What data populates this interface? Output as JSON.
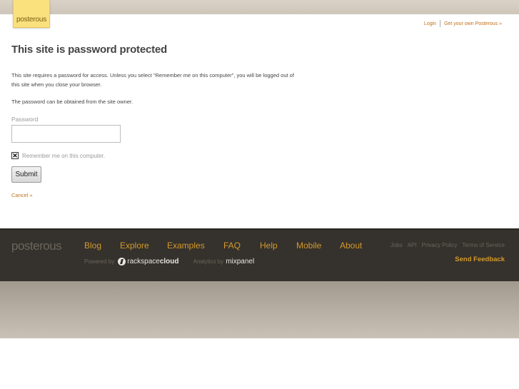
{
  "header": {
    "logo_text": "posterous",
    "login_label": "Login",
    "get_own_label": "Get your own Posterous »"
  },
  "main": {
    "title": "This site is password protected",
    "intro_text": "This site requires a password for access. Unless you select \"Remember me on this computer\", you will be logged out of this site when you close your browser.",
    "obtain_text": "The password can be obtained from the site owner.",
    "password_label": "Password",
    "password_value": "",
    "remember_label": "Remember me on this computer.",
    "remember_checked": true,
    "submit_label": "Submit",
    "cancel_label": "Cancel »"
  },
  "footer": {
    "logo_text": "posterous",
    "nav": [
      {
        "label": "Blog"
      },
      {
        "label": "Explore"
      },
      {
        "label": "Examples"
      },
      {
        "label": "FAQ"
      },
      {
        "label": "Help"
      },
      {
        "label": "Mobile"
      },
      {
        "label": "About"
      }
    ],
    "small_links": [
      {
        "label": "Jobs"
      },
      {
        "label": "API"
      },
      {
        "label": "Privacy Policy"
      },
      {
        "label": "Terms of Service"
      }
    ],
    "powered_by_label": "Powered by",
    "rackspace_text_light": "rackspace",
    "rackspace_text_bold": "cloud",
    "analytics_label": "Analytics by",
    "mixpanel_text": "mixpanel",
    "feedback_label": "Send Feedback"
  },
  "colors": {
    "accent": "#d49a2a",
    "link": "#c0701a",
    "footer_bg": "#35312c",
    "logo_bg": "#fbe17d"
  }
}
